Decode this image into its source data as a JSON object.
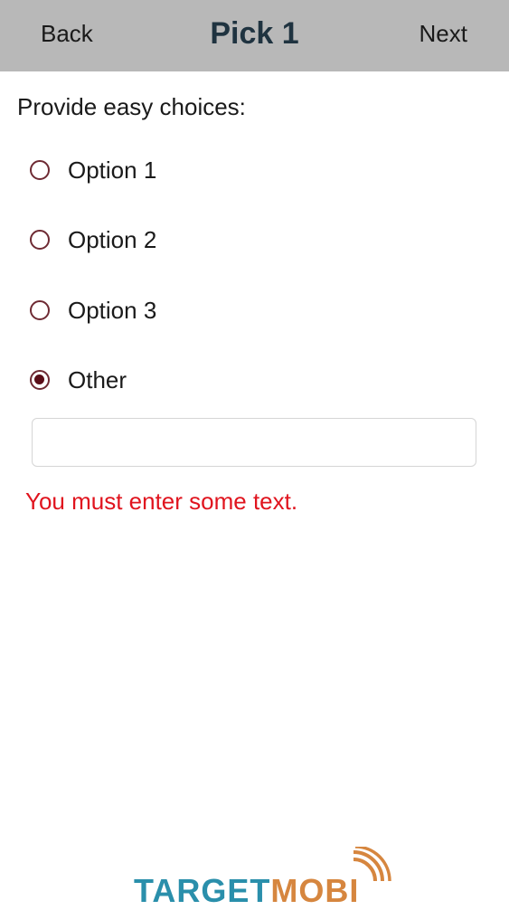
{
  "header": {
    "back_label": "Back",
    "title": "Pick 1",
    "next_label": "Next"
  },
  "question": {
    "prompt": "Provide easy choices:",
    "options": [
      {
        "label": "Option 1",
        "selected": false
      },
      {
        "label": "Option 2",
        "selected": false
      },
      {
        "label": "Option 3",
        "selected": false
      },
      {
        "label": "Other",
        "selected": true
      }
    ],
    "other_input": {
      "value": "",
      "placeholder": ""
    },
    "error_message": "You must enter some text."
  },
  "logo": {
    "part1": "TARGET",
    "part2": "MOBI"
  },
  "colors": {
    "header_bg": "#b8b8b8",
    "radio_ring": "#6e2a33",
    "radio_fill": "#5a0e18",
    "error": "#e0141e",
    "logo_blue": "#2a8fab",
    "logo_orange": "#d6863f"
  }
}
